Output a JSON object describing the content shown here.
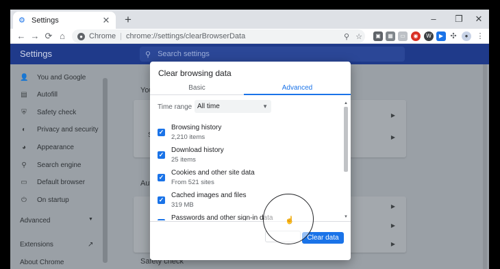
{
  "browser": {
    "tab_title": "Settings",
    "tab_close": "✕",
    "new_tab": "+",
    "window_controls": {
      "minimize": "–",
      "maximize": "❐",
      "close": "✕"
    },
    "nav": {
      "back": "←",
      "forward": "→",
      "reload": "C",
      "home": "⌂"
    },
    "omnibox": {
      "site_label": "Chrome",
      "separator": "|",
      "url": "chrome://settings/clearBrowserData"
    },
    "icons": [
      "search-icon",
      "star-icon"
    ],
    "extensions": [
      "ext-1",
      "ext-2",
      "ext-3",
      "ext-4",
      "ext-5",
      "ext-6",
      "ext-7",
      "puzzle-icon",
      "profile-icon",
      "menu-icon"
    ]
  },
  "settings": {
    "title": "Settings",
    "search_placeholder": "Search settings",
    "sidebar": [
      {
        "label": "You and Google",
        "icon": "person-icon",
        "glyph": "👤"
      },
      {
        "label": "Autofill",
        "icon": "clipboard-icon",
        "glyph": "▤"
      },
      {
        "label": "Safety check",
        "icon": "shield-icon",
        "glyph": "⛨"
      },
      {
        "label": "Privacy and security",
        "icon": "shield-icon",
        "glyph": "◐"
      },
      {
        "label": "Appearance",
        "icon": "palette-icon",
        "glyph": "◕"
      },
      {
        "label": "Search engine",
        "icon": "search-icon",
        "glyph": "⚲"
      },
      {
        "label": "Default browser",
        "icon": "browser-icon",
        "glyph": "▭"
      },
      {
        "label": "On startup",
        "icon": "power-icon",
        "glyph": "⏻"
      }
    ],
    "advanced_label": "Advanced",
    "extensions_label": "Extensions",
    "about_label": "About Chrome",
    "content": {
      "section_you_truncated": "You",
      "section_autofill_truncated": "Aut",
      "section_safety": "Safety check",
      "row_letter_s": "S"
    }
  },
  "dialog": {
    "title": "Clear browsing data",
    "tabs": {
      "basic": "Basic",
      "advanced": "Advanced",
      "active": "advanced"
    },
    "time_range_label": "Time range",
    "time_range_value": "All time",
    "options": [
      {
        "title": "Browsing history",
        "subtitle": "2,210 items",
        "checked": true
      },
      {
        "title": "Download history",
        "subtitle": "25 items",
        "checked": true
      },
      {
        "title": "Cookies and other site data",
        "subtitle": "From 521 sites",
        "checked": true
      },
      {
        "title": "Cached images and files",
        "subtitle": "319 MB",
        "checked": true
      },
      {
        "title": "Passwords and other sign-in data",
        "subtitle": "",
        "checked": true
      }
    ],
    "clear_button": "Clear data"
  },
  "colors": {
    "accent": "#1a73e8",
    "header_bg": "#1f3a8a",
    "overlay_page": "#9aa0a6"
  }
}
